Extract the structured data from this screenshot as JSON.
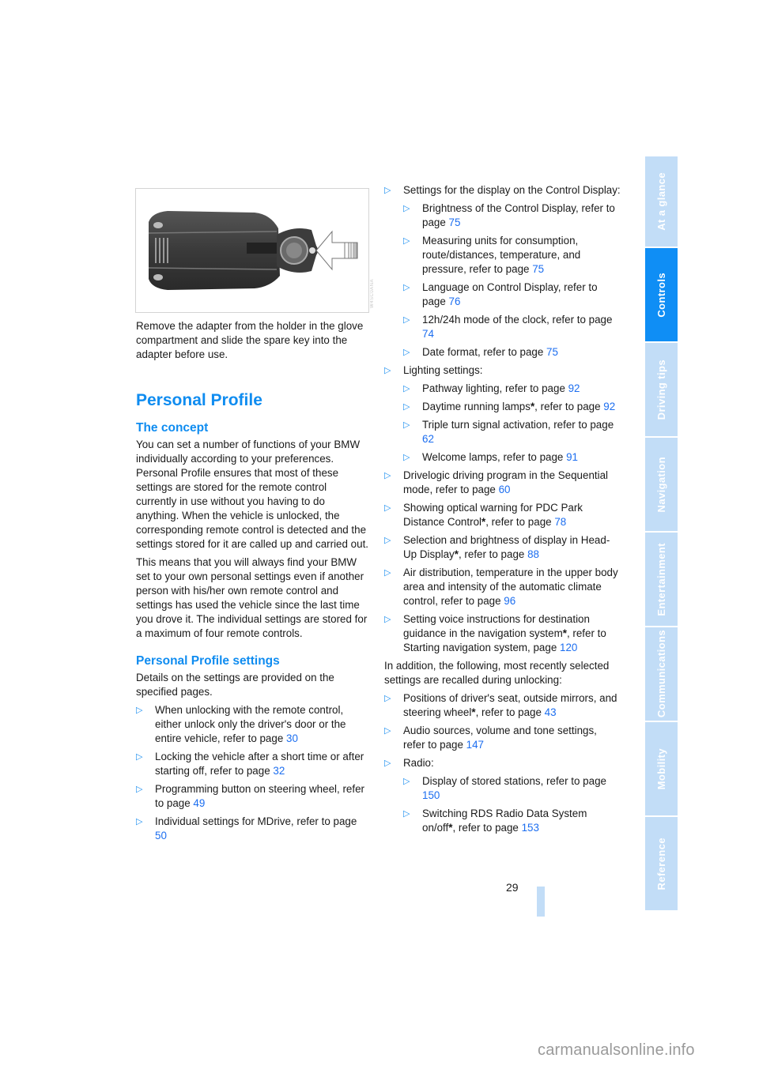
{
  "figure": {
    "name": "spare-key-adapter-illustration",
    "code": "W4SC0ANA"
  },
  "left_column": {
    "intro": "Remove the adapter from the holder in the glove compartment and slide the spare key into the adapter before use.",
    "section_title": "Personal Profile",
    "concept": {
      "title": "The concept",
      "paragraphs": [
        "You can set a number of functions of your BMW individually according to your preferences. Personal Profile ensures that most of these settings are stored for the remote control currently in use without you having to do anything. When the vehicle is unlocked, the corresponding remote control is detected and the settings stored for it are called up and carried out.",
        "This means that you will always find your BMW set to your own personal settings even if another person with his/her own remote control and settings has used the vehicle since the last time you drove it. The individual settings are stored for a maximum of four remote controls."
      ]
    },
    "settings": {
      "title": "Personal Profile settings",
      "intro": "Details on the settings are provided on the specified pages.",
      "items": [
        {
          "text": "When unlocking with the remote control, either unlock only the driver's door or the entire vehicle, refer to page ",
          "page": "30"
        },
        {
          "text": "Locking the vehicle after a short time or after starting off, refer to page ",
          "page": "32"
        },
        {
          "text": "Programming button on steering wheel, refer to page ",
          "page": "49"
        },
        {
          "text": "Individual settings for MDrive, refer to page ",
          "page": "50"
        }
      ]
    }
  },
  "right_column": {
    "display_settings": {
      "text": "Settings for the display on the Control Display:",
      "items": [
        {
          "text": "Brightness of the Control Display, refer to page ",
          "page": "75"
        },
        {
          "text": "Measuring units for consumption, route/distances, temperature, and pressure, refer to page ",
          "page": "75"
        },
        {
          "text": "Language on Control Display, refer to page ",
          "page": "76"
        },
        {
          "text": "12h/24h mode of the clock, refer to page ",
          "page": "74"
        },
        {
          "text": "Date format, refer to page ",
          "page": "75"
        }
      ]
    },
    "lighting_settings": {
      "text": "Lighting settings:",
      "items": [
        {
          "text": "Pathway lighting, refer to page ",
          "page": "92"
        },
        {
          "text": "Daytime running lamps",
          "star": "*",
          "text2": ", refer to page ",
          "page": "92"
        },
        {
          "text": "Triple turn signal activation, refer to page ",
          "page": "62"
        },
        {
          "text": "Welcome lamps, refer to page ",
          "page": "91"
        }
      ]
    },
    "more_items": [
      {
        "text": "Drivelogic driving program in the Sequential mode, refer to page ",
        "page": "60"
      },
      {
        "text": "Showing optical warning for PDC Park Distance Control",
        "star": "*",
        "text2": ", refer to page ",
        "page": "78"
      },
      {
        "text": "Selection and brightness of display in Head-Up Display",
        "star": "*",
        "text2": ", refer to page ",
        "page": "88"
      },
      {
        "text": "Air distribution, temperature in the upper body area and intensity of the automatic climate control, refer to page ",
        "page": "96"
      },
      {
        "text": "Setting voice instructions for destination guidance in the navigation system",
        "star": "*",
        "text2": ", refer to Starting navigation system, page ",
        "page": "120"
      }
    ],
    "recalled_intro": "In addition, the following, most recently selected settings are recalled during unlocking:",
    "recalled_items": [
      {
        "text": "Positions of driver's seat, outside mirrors, and steering wheel",
        "star": "*",
        "text2": ", refer to page ",
        "page": "43"
      },
      {
        "text": "Audio sources, volume and tone settings, refer to page ",
        "page": "147"
      }
    ],
    "radio": {
      "text": "Radio:",
      "items": [
        {
          "text": "Display of stored stations, refer to page ",
          "page": "150"
        },
        {
          "text": "Switching RDS Radio Data System on/off",
          "star": "*",
          "text2": ", refer to page ",
          "page": "153"
        }
      ]
    }
  },
  "side_tabs": [
    {
      "label": "At a glance",
      "active": false
    },
    {
      "label": "Controls",
      "active": true
    },
    {
      "label": "Driving tips",
      "active": false
    },
    {
      "label": "Navigation",
      "active": false
    },
    {
      "label": "Entertainment",
      "active": false
    },
    {
      "label": "Communications",
      "active": false
    },
    {
      "label": "Mobility",
      "active": false
    },
    {
      "label": "Reference",
      "active": false
    }
  ],
  "colors": {
    "accent": "#0f8ef5",
    "tab_inactive": "#c2ddf7",
    "link": "#1c6ef0"
  },
  "bullet_glyph": "▷",
  "page_number": "29",
  "watermark": "carmanualsonline.info"
}
